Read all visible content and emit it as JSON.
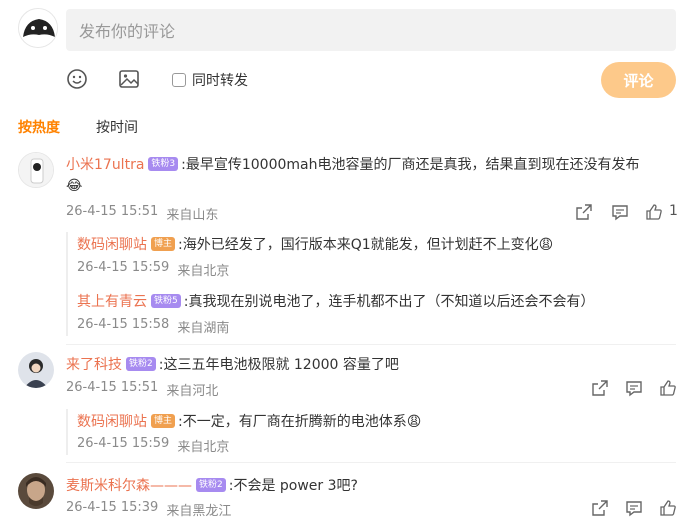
{
  "composer": {
    "placeholder": "发布你的评论",
    "sync_label": "同时转发",
    "submit_label": "评论"
  },
  "sort_tabs": [
    {
      "label": "按热度",
      "active": true
    },
    {
      "label": "按时间",
      "active": false
    }
  ],
  "comments": [
    {
      "user": "小米17ultra",
      "badge": "铁粉3",
      "text": ":最早宣传10000mah电池容量的厂商还是真我，结果直到现在还没有发布",
      "text_line2": "😂",
      "date": "26-4-15 15:51",
      "location": "来自山东",
      "likes": "1",
      "replies": [
        {
          "user": "数码闲聊站",
          "badge": "博主",
          "text": ":海外已经发了，国行版本来Q1就能发，但计划赶不上变化😩",
          "date": "26-4-15 15:59",
          "location": "来自北京"
        },
        {
          "user": "其上有青云",
          "badge": "铁粉5",
          "text": ":真我现在别说电池了，连手机都不出了（不知道以后还会不会有）",
          "date": "26-4-15 15:58",
          "location": "来自湖南"
        }
      ]
    },
    {
      "user": "来了科技",
      "badge": "铁粉2",
      "text": ":这三五年电池极限就 12000 容量了吧",
      "date": "26-4-15 15:51",
      "location": "来自河北",
      "replies": [
        {
          "user": "数码闲聊站",
          "badge": "博主",
          "text": ":不一定，有厂商在折腾新的电池体系😩",
          "date": "26-4-15 15:59",
          "location": "来自北京"
        }
      ]
    },
    {
      "user": "麦斯米科尔森———",
      "badge": "铁粉2",
      "text": ":不会是 power 3吧?",
      "date": "26-4-15 15:39",
      "location": "来自黑龙江"
    }
  ],
  "colors": {
    "accent": "#ff8200",
    "username": "#eb7350",
    "submit": "#fdc98a",
    "fan_badge": "#a78bf0",
    "blogger_badge": "#f0a050"
  }
}
